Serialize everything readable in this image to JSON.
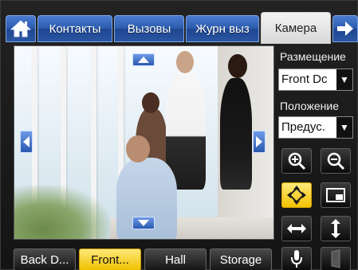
{
  "tabs": [
    {
      "id": "home",
      "label": "",
      "icon": "home-icon"
    },
    {
      "id": "contacts",
      "label": "Контакты"
    },
    {
      "id": "calls",
      "label": "Вызовы"
    },
    {
      "id": "log",
      "label": "Журн выз"
    },
    {
      "id": "camera",
      "label": "Камера",
      "active": true
    },
    {
      "id": "next",
      "label": "",
      "icon": "arrow-right-icon"
    }
  ],
  "right_panel": {
    "placement_label": "Размещение",
    "placement_value": "Front Dc",
    "position_label": "Положение",
    "position_value": "Предус."
  },
  "controls": [
    {
      "name": "zoom-in-button",
      "icon": "zoom-in-icon"
    },
    {
      "name": "zoom-out-button",
      "icon": "zoom-out-icon"
    },
    {
      "name": "pan-tilt-button",
      "icon": "pan-tilt-icon",
      "active": true
    },
    {
      "name": "pip-button",
      "icon": "picture-in-picture-icon"
    },
    {
      "name": "swap-horizontal-button",
      "icon": "horizontal-flip-icon"
    },
    {
      "name": "swap-vertical-button",
      "icon": "vertical-flip-icon"
    },
    {
      "name": "microphone-button",
      "icon": "microphone-icon"
    },
    {
      "name": "door-button",
      "icon": "door-icon",
      "disabled": true
    }
  ],
  "presets": [
    {
      "label": "Back D..."
    },
    {
      "label": "Front...",
      "active": true
    },
    {
      "label": "Hall"
    },
    {
      "label": "Storage"
    }
  ],
  "colors": {
    "tab_blue": "#2d5cad",
    "active_yellow": "#f2c200",
    "background": "#1a1a1a"
  }
}
